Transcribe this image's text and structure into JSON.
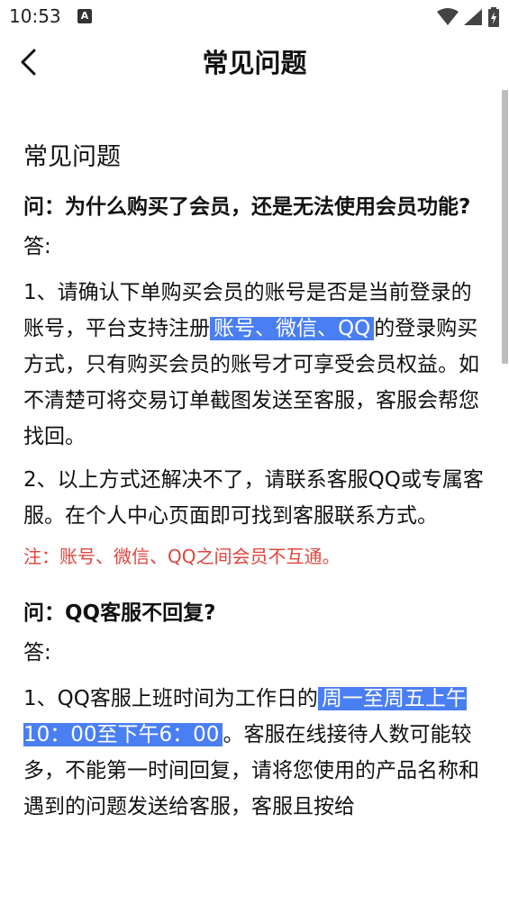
{
  "status_bar": {
    "time": "10:53",
    "notif_badge": "A"
  },
  "app_bar": {
    "title": "常见问题"
  },
  "content": {
    "section_title": "常见问题",
    "q1": {
      "question": "问：为什么购买了会员，还是无法使用会员功能?",
      "answer_label": "答:",
      "p1_part1": "1、请确认下单购买会员的账号是否是当前登录的账号，平台支持注册",
      "p1_highlight": "账号、微信、QQ",
      "p1_part2": "的登录购买方式，只有购买会员的账号才可享受会员权益。如不清楚可将交易订单截图发送至客服，客服会帮您找回。",
      "p2": "2、以上方式还解决不了，请联系客服QQ或专属客服。在个人中心页面即可找到客服联系方式。",
      "note": "注：账号、微信、QQ之间会员不互通。"
    },
    "q2": {
      "question": "问：QQ客服不回复?",
      "answer_label": "答:",
      "p1_part1": "1、QQ客服上班时间为工作日的",
      "p1_highlight": "周一至周五上午10：00至下午6：00",
      "p1_part2": "。客服在线接待人数可能较多，不能第一时间回复，请将您使用的产品名称和遇到的问题发送给客服，客服且按给"
    }
  },
  "colors": {
    "highlight": "#4a7ef3",
    "note": "#e0443e",
    "scrollbar": "#bdbdbd"
  }
}
